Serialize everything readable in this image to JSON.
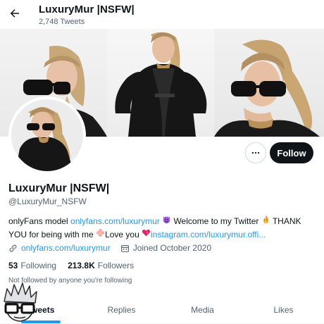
{
  "header": {
    "title": "LuxuryMur |NSFW|",
    "tweet_count": "2,748 Tweets"
  },
  "profile": {
    "display_name": "LuxuryMur |NSFW|",
    "handle": "@LuxuryMur_NSFW",
    "follow_label": "Follow"
  },
  "bio": {
    "part1": "onlyFans model ",
    "link1": "onlyfans.com/luxurymur",
    "part2": " Welcome to my Twitter ",
    "part3": " THANK YOU for being with me ",
    "part4": "Love you ",
    "link2": "instagram.com/luxurymur.offi..."
  },
  "meta": {
    "website": "onlyfans.com/luxurymur",
    "joined": "Joined October 2020"
  },
  "counts": {
    "following_num": "53",
    "following_label": "Following",
    "followers_num": "213.8K",
    "followers_label": "Followers"
  },
  "followed_by": "Not followed by anyone you're following",
  "tabs": [
    {
      "label": "Tweets",
      "active": true
    },
    {
      "label": "Replies",
      "active": false
    },
    {
      "label": "Media",
      "active": false
    },
    {
      "label": "Likes",
      "active": false
    }
  ],
  "colors": {
    "accent": "#1d9bf0",
    "text": "#0f1419",
    "secondary": "#536471",
    "follow_button": "#0f1419"
  }
}
